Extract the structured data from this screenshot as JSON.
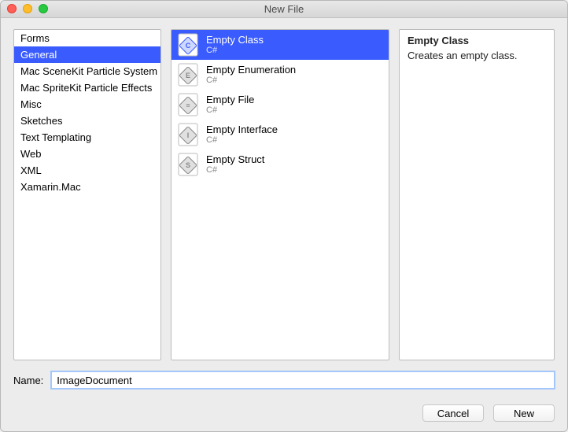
{
  "window": {
    "title": "New File"
  },
  "categories": [
    "Forms",
    "General",
    "Mac SceneKit Particle System",
    "Mac SpriteKit Particle Effects",
    "Misc",
    "Sketches",
    "Text Templating",
    "Web",
    "XML",
    "Xamarin.Mac"
  ],
  "selectedCategoryIndex": 1,
  "templates": [
    {
      "name": "Empty Class",
      "lang": "C#",
      "iconLetter": "C"
    },
    {
      "name": "Empty Enumeration",
      "lang": "C#",
      "iconLetter": "E"
    },
    {
      "name": "Empty File",
      "lang": "C#",
      "iconLetter": "≡"
    },
    {
      "name": "Empty Interface",
      "lang": "C#",
      "iconLetter": "I"
    },
    {
      "name": "Empty Struct",
      "lang": "C#",
      "iconLetter": "S"
    }
  ],
  "selectedTemplateIndex": 0,
  "description": {
    "title": "Empty Class",
    "body": "Creates an empty class."
  },
  "nameField": {
    "label": "Name:",
    "value": "ImageDocument"
  },
  "buttons": {
    "cancel": "Cancel",
    "new": "New"
  }
}
